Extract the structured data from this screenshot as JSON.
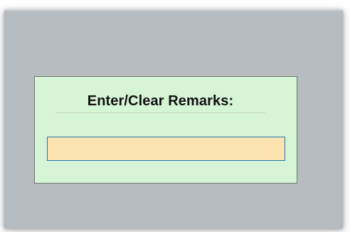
{
  "remarks": {
    "title": "Enter/Clear Remarks:",
    "input_value": "",
    "input_placeholder": ""
  },
  "colors": {
    "window_background": "#b7bcc1",
    "panel_background": "#d6f4d6",
    "input_background": "#fde3b0",
    "input_border": "#1f77b4"
  }
}
